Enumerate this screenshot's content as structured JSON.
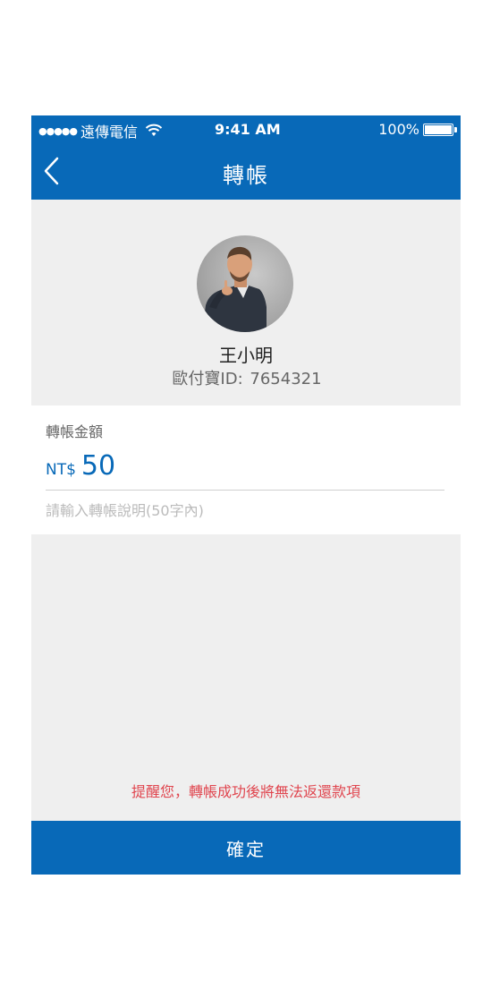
{
  "status_bar": {
    "signal_dots": "●●●●●",
    "carrier": "遠傳電信",
    "time": "9:41 AM",
    "battery": "100%"
  },
  "nav": {
    "title": "轉帳",
    "back_icon": "chevron-left-icon"
  },
  "recipient": {
    "name": "王小明",
    "id_label": "歐付寶ID:",
    "id_value": "7654321"
  },
  "transfer": {
    "amount_label": "轉帳金額",
    "currency": "NT$",
    "amount": "50",
    "memo_placeholder": "請輸入轉帳說明(50字內)"
  },
  "warning": "提醒您，轉帳成功後將無法返還款項",
  "confirm_label": "確定",
  "colors": {
    "primary": "#0869b8",
    "background_gray": "#efefef",
    "warning": "#e0464f"
  }
}
